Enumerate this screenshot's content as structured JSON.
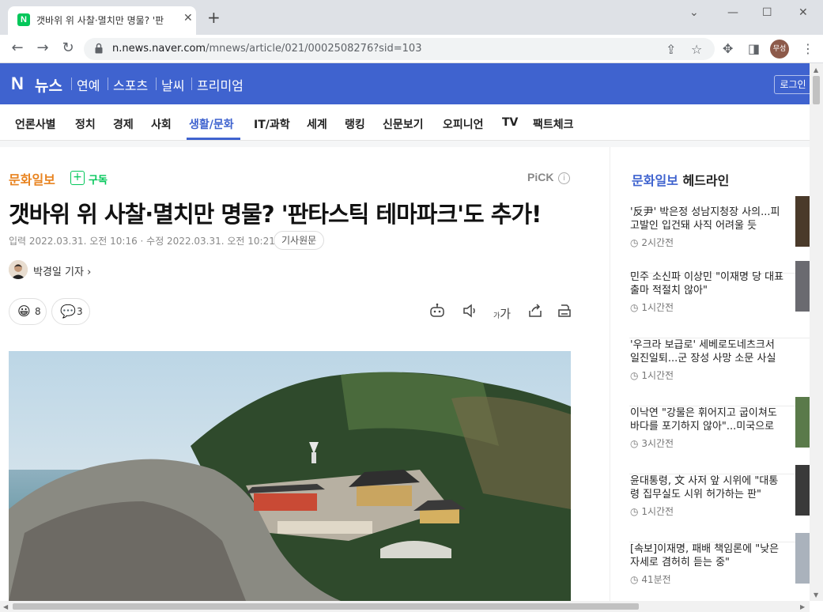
{
  "browser": {
    "tab_title": "갯바위 위 사찰·멸치만 명물? '판",
    "tab_favicon": "N",
    "url_host": "n.news.naver.com",
    "url_path": "/mnews/article/021/0002508276?sid=103",
    "profile_label": "무성"
  },
  "header": {
    "logo": "N",
    "logo_text": "뉴스",
    "nav": [
      "연예",
      "스포츠",
      "날씨",
      "프리미엄"
    ],
    "login": "로그인"
  },
  "categories": [
    "언론사별",
    "정치",
    "경제",
    "사회",
    "생활/문화",
    "IT/과학",
    "세계",
    "랭킹",
    "신문보기",
    "오피니언",
    "TV",
    "팩트체크"
  ],
  "active_category": "생활/문화",
  "article": {
    "press": "문화일보",
    "subscribe": "구독",
    "pick": "PiCK",
    "headline": "갯바위 위 사찰·멸치만 명물? '판타스틱 테마파크'도 추가!",
    "dateline": "입력 2022.03.31. 오전 10:16 · 수정 2022.03.31. 오전 10:21",
    "original_button": "기사원문",
    "reporter": "박경일 기자",
    "reactions": {
      "emoji_count": "8",
      "comment_count": "3"
    },
    "font_size_label": "가"
  },
  "sidebar": {
    "press": "문화일보",
    "title_suffix": " 헤드라인",
    "items": [
      {
        "title": "'反尹' 박은정 성남지청장 사의...피고발인 입건돼 사직 어려울 듯",
        "time": "2시간전"
      },
      {
        "title": "민주 소신파 이상민 \"이재명 당 대표 출마 적절치 않아\"",
        "time": "1시간전"
      },
      {
        "title": "'우크라 보급로' 세베로도네츠크서 일진일퇴...군 장성 사망 소문 사실로",
        "time": "1시간전"
      },
      {
        "title": "이낙연 \"강물은 휘어지고 굽이쳐도 바다를 포기하지 않아\"...미국으로 ...",
        "time": "3시간전"
      },
      {
        "title": "윤대통령, 文 사저 앞 시위에 \"대통령 집무실도 시위 허가하는 판\"",
        "time": "1시간전"
      },
      {
        "title": "[속보]이재명, 패배 책임론에 \"낮은 자세로 겸허히 듣는 중\"",
        "time": "41분전"
      }
    ]
  },
  "colors": {
    "naver_blue": "#3f63cf",
    "press_orange": "#e8831f",
    "subscribe_green": "#03c75a"
  }
}
